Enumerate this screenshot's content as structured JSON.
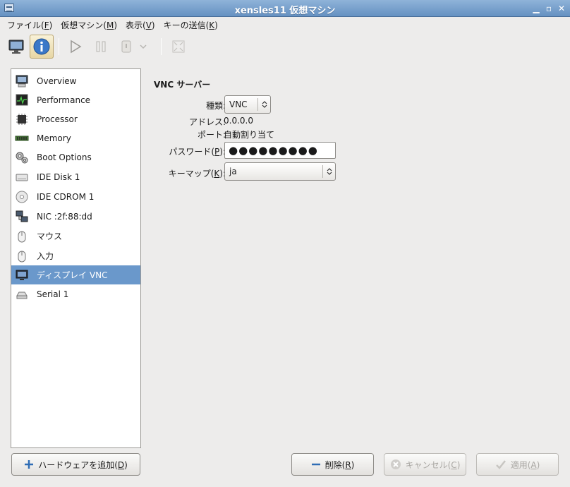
{
  "window": {
    "title": "xensles11 仮想マシン"
  },
  "menubar": {
    "items": [
      {
        "label": "ファイル(",
        "mnemonic": "F",
        "suffix": ")"
      },
      {
        "label": "仮想マシン(",
        "mnemonic": "M",
        "suffix": ")"
      },
      {
        "label": "表示(",
        "mnemonic": "V",
        "suffix": ")"
      },
      {
        "label": "キーの送信(",
        "mnemonic": "K",
        "suffix": ")"
      }
    ]
  },
  "sidebar": {
    "items": [
      {
        "label": "Overview",
        "icon": "computer-icon"
      },
      {
        "label": "Performance",
        "icon": "performance-icon"
      },
      {
        "label": "Processor",
        "icon": "processor-icon"
      },
      {
        "label": "Memory",
        "icon": "memory-icon"
      },
      {
        "label": "Boot Options",
        "icon": "gears-icon"
      },
      {
        "label": "IDE Disk 1",
        "icon": "disk-icon"
      },
      {
        "label": "IDE CDROM 1",
        "icon": "cdrom-icon"
      },
      {
        "label": "NIC :2f:88:dd",
        "icon": "network-icon"
      },
      {
        "label": "マウス",
        "icon": "mouse-icon"
      },
      {
        "label": "入力",
        "icon": "mouse-icon"
      },
      {
        "label": "ディスプレイ VNC",
        "icon": "display-icon"
      },
      {
        "label": "Serial 1",
        "icon": "serial-icon"
      }
    ],
    "selected_index": 10
  },
  "vnc": {
    "section_title": "VNC サーバー",
    "type_label": "種類:",
    "type_value": "VNC",
    "address_label": "アドレス:",
    "address_value": "0.0.0.0",
    "port_label": "ポート:",
    "port_value": "自動割り当て",
    "password_label_pre": "パスワード(",
    "password_mnemonic": "P",
    "password_label_post": "):",
    "password_value": "●●●●●●●●●",
    "keymap_label_pre": "キーマップ(",
    "keymap_mnemonic": "K",
    "keymap_label_post": "):",
    "keymap_value": "ja"
  },
  "buttons": {
    "add_hardware_pre": "ハードウェアを追加(",
    "add_hardware_mnemonic": "D",
    "add_hardware_post": ")",
    "remove_pre": "削除(",
    "remove_mnemonic": "R",
    "remove_post": ")",
    "cancel_pre": "キャンセル(",
    "cancel_mnemonic": "C",
    "cancel_post": ")",
    "apply_pre": "適用(",
    "apply_mnemonic": "A",
    "apply_post": ")"
  },
  "colors": {
    "selection": "#6a98cb",
    "titlebar": "#6591c2"
  }
}
